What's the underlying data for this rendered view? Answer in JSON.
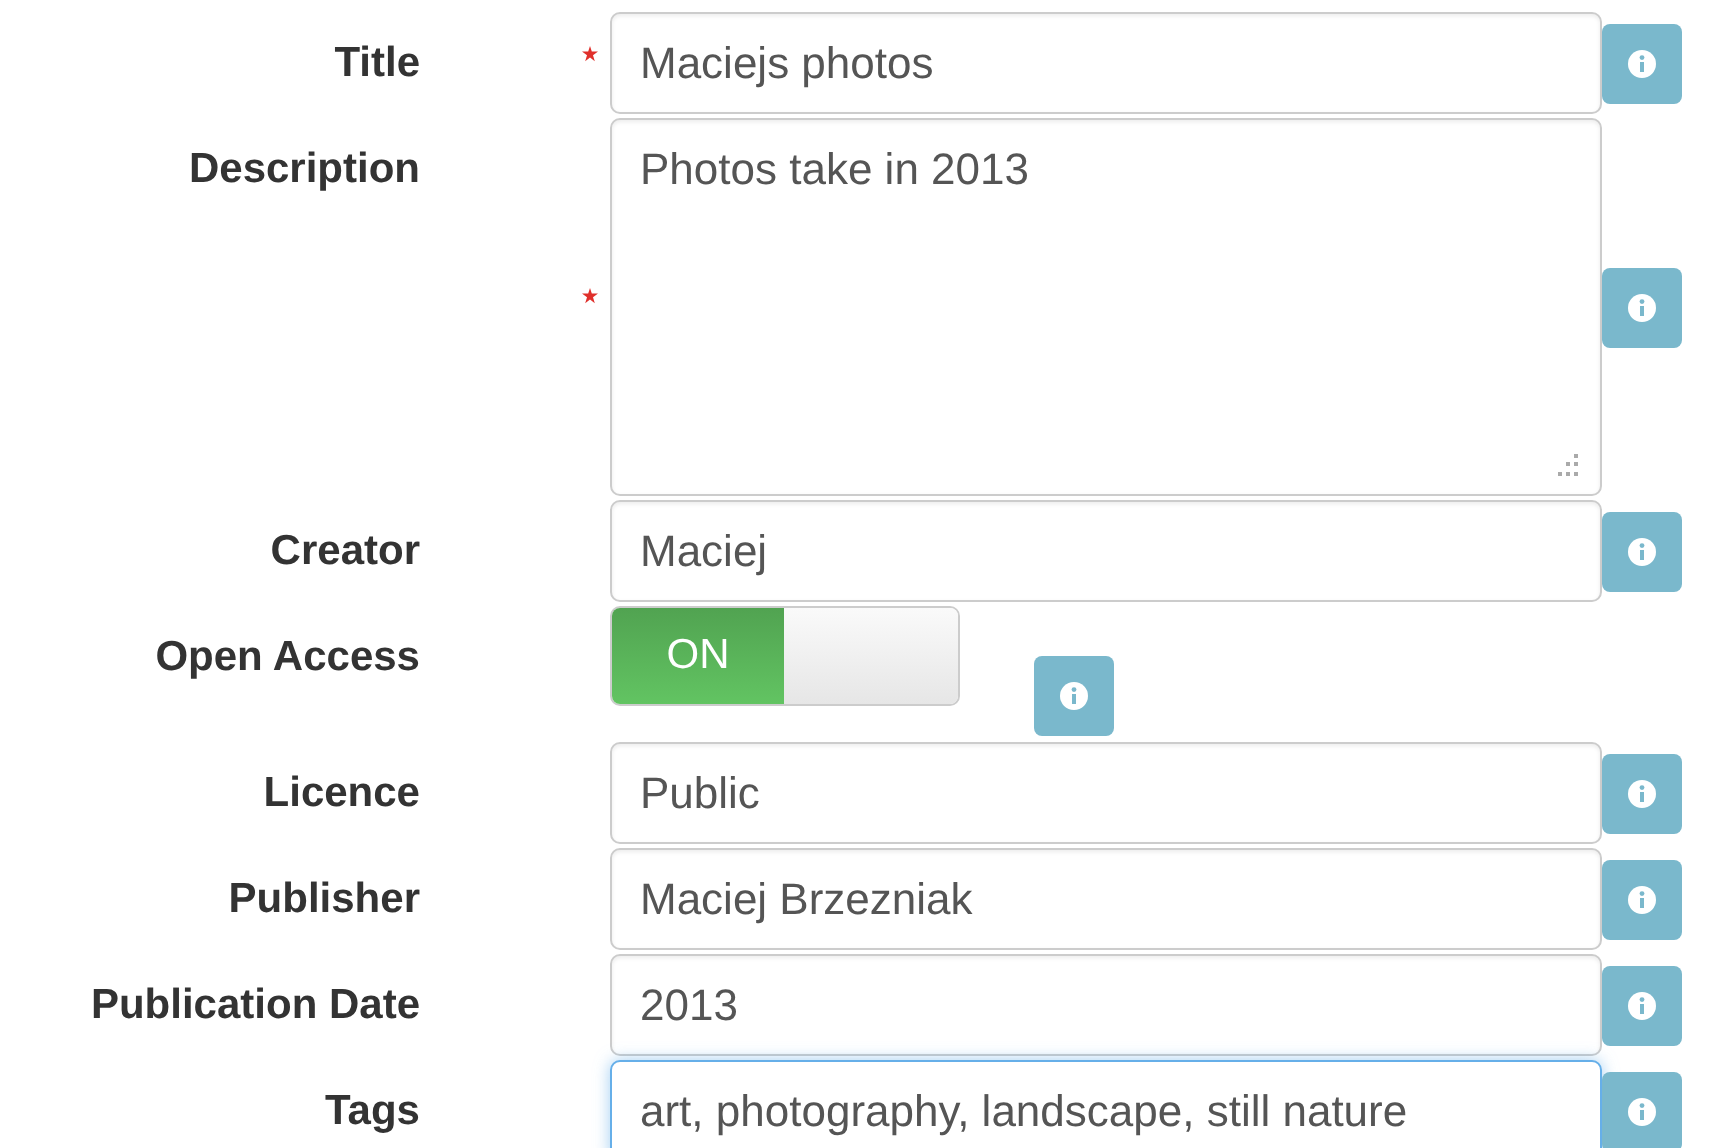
{
  "fields": [
    {
      "kind": "text",
      "label": "Title",
      "required": true,
      "value": "Maciejs photos",
      "focused": false
    },
    {
      "kind": "textarea",
      "label": "Description",
      "required": true,
      "value": "Photos take in 2013",
      "focused": false
    },
    {
      "kind": "text",
      "label": "Creator",
      "required": false,
      "value": "Maciej",
      "focused": false
    },
    {
      "kind": "toggle",
      "label": "Open Access",
      "on": true,
      "on_label": "ON"
    },
    {
      "kind": "text",
      "label": "Licence",
      "required": false,
      "value": "Public",
      "focused": false
    },
    {
      "kind": "text",
      "label": "Publisher",
      "required": false,
      "value": "Maciej Brzezniak",
      "focused": false
    },
    {
      "kind": "text",
      "label": "Publication Date",
      "required": false,
      "value": "2013",
      "focused": false
    },
    {
      "kind": "text",
      "label": "Tags",
      "required": false,
      "value": "art, photography, landscape, still nature",
      "focused": true
    }
  ]
}
